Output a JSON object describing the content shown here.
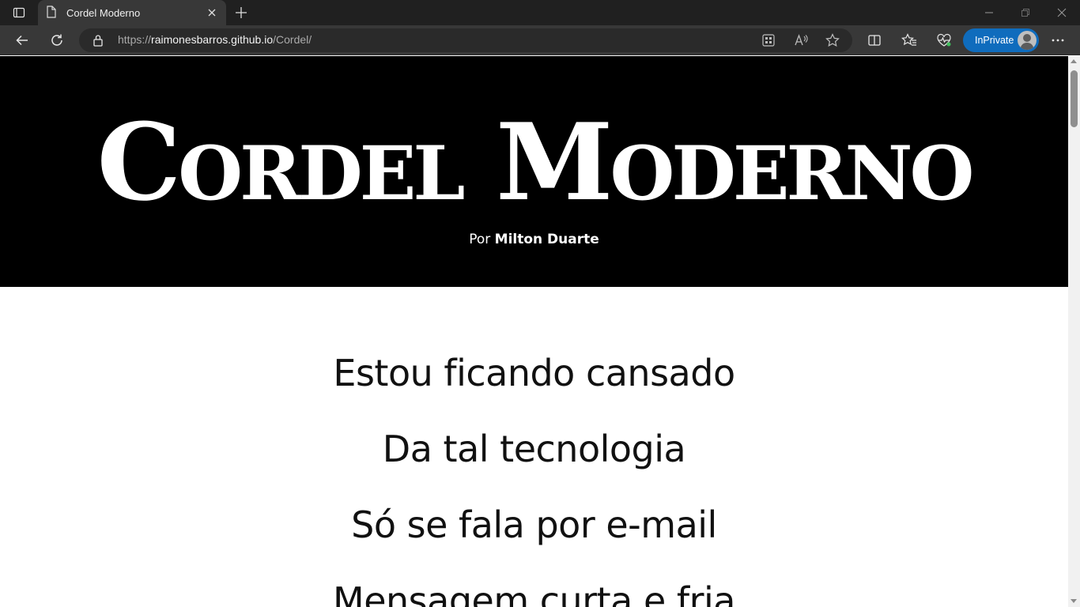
{
  "browser": {
    "tab_title": "Cordel Moderno",
    "url_scheme": "https://",
    "url_host": "raimonesbarros.github.io",
    "url_path": "/Cordel/",
    "inprivate_label": "InPrivate",
    "accent_color": "#0f6cbd"
  },
  "hero": {
    "title": "Cordel Moderno",
    "byline_prefix": "Por ",
    "author": "Milton Duarte",
    "background": "#000000"
  },
  "poem": {
    "verses": [
      "Estou ficando cansado",
      "Da tal tecnologia",
      "Só se fala por e-mail",
      "Mensagem curta e fria"
    ]
  },
  "icons": {
    "tab_actions": "tab-actions-icon",
    "page": "page-icon",
    "close": "close-icon",
    "new_tab": "plus-icon",
    "back": "back-arrow-icon",
    "refresh": "refresh-icon",
    "lock": "lock-icon",
    "apps": "app-available-icon",
    "read_aloud": "read-aloud-icon",
    "favorite": "star-icon",
    "split": "split-screen-icon",
    "favorites": "favorites-icon",
    "performance": "heartbeat-icon",
    "menu": "more-icon"
  }
}
